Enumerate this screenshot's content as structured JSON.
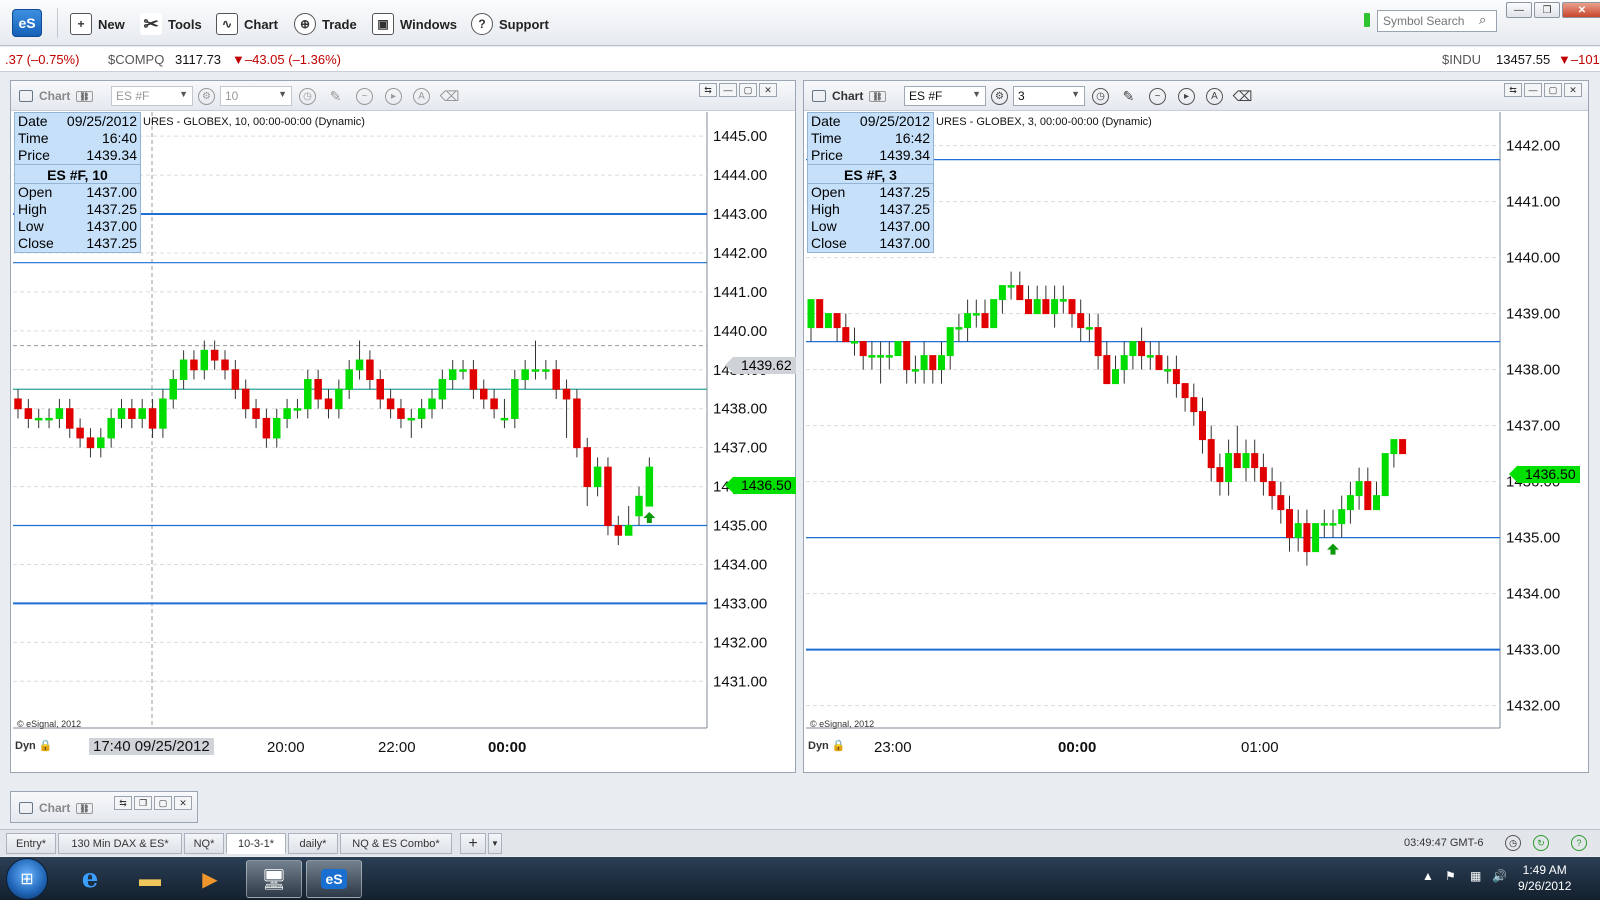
{
  "toolbar": {
    "logo": "eS",
    "new": "New",
    "tools": "Tools",
    "chart": "Chart",
    "trade": "Trade",
    "windows": "Windows",
    "support": "Support",
    "search_placeholder": "Symbol Search"
  },
  "ticker": {
    "left_change": ".37 (–0.75%)",
    "compq_symbol": "$COMPQ",
    "compq_last": "3117.73",
    "compq_change": "▼–43.05 (–1.36%)",
    "indu_symbol": "$INDU",
    "indu_last": "13457.55",
    "indu_change": "▼–101"
  },
  "charts": [
    {
      "title": "Chart",
      "symbol": "ES #F",
      "interval": "10",
      "caption": "URES - GLOBEX, 10, 00:00-00:00 (Dynamic)",
      "info": {
        "date_label": "Date",
        "date": "09/25/2012",
        "time_label": "Time",
        "time": "16:40",
        "price_label": "Price",
        "price": "1439.34",
        "head": "ES #F, 10",
        "open_label": "Open",
        "open": "1437.00",
        "high_label": "High",
        "high": "1437.25",
        "low_label": "Low",
        "low": "1437.00",
        "close_label": "Close",
        "close": "1437.25"
      },
      "last_price": "1436.50",
      "cursor_price": "1439.62",
      "copyright": "© eSignal, 2012",
      "dyn": "Dyn",
      "cursor_time": "17:40 09/25/2012",
      "time_labels": [
        "20:00",
        "22:00",
        "00:00"
      ]
    },
    {
      "title": "Chart",
      "symbol": "ES #F",
      "interval": "3",
      "caption": "URES - GLOBEX, 3, 00:00-00:00 (Dynamic)",
      "info": {
        "date_label": "Date",
        "date": "09/25/2012",
        "time_label": "Time",
        "time": "16:42",
        "price_label": "Price",
        "price": "1439.34",
        "head": "ES #F, 3",
        "open_label": "Open",
        "open": "1437.25",
        "high_label": "High",
        "high": "1437.25",
        "low_label": "Low",
        "low": "1437.00",
        "close_label": "Close",
        "close": "1437.00"
      },
      "last_price": "1436.50",
      "copyright": "© eSignal, 2012",
      "dyn": "Dyn",
      "time_labels": [
        "23:00",
        "00:00",
        "01:00"
      ]
    }
  ],
  "chart_data": [
    {
      "type": "candlestick",
      "title": "",
      "ylim": [
        1430,
        1446
      ],
      "y_ticks": [
        "1431.00",
        "1432.00",
        "1433.00",
        "1434.00",
        "1435.00",
        "1436.00",
        "1437.00",
        "1438.00",
        "1439.00",
        "1440.00",
        "1441.00",
        "1442.00",
        "1443.00",
        "1444.00",
        "1445.00"
      ],
      "x_ticks": [
        "20:00",
        "22:00",
        "00:00"
      ],
      "horizontal_lines": [
        1443.0,
        1441.75,
        1438.5,
        1435.0,
        1433.0
      ],
      "last_price": 1436.5,
      "candles": [
        [
          1438.25,
          1438.5,
          1437.75,
          1438.0
        ],
        [
          1438.0,
          1438.25,
          1437.5,
          1437.75
        ],
        [
          1437.75,
          1438.0,
          1437.5,
          1437.75
        ],
        [
          1437.75,
          1438.0,
          1437.5,
          1437.75
        ],
        [
          1437.75,
          1438.25,
          1437.5,
          1438.0
        ],
        [
          1438.0,
          1438.25,
          1437.25,
          1437.5
        ],
        [
          1437.5,
          1437.75,
          1437.0,
          1437.25
        ],
        [
          1437.25,
          1437.5,
          1436.75,
          1437.0
        ],
        [
          1437.0,
          1437.5,
          1436.75,
          1437.25
        ],
        [
          1437.25,
          1438.0,
          1437.0,
          1437.75
        ],
        [
          1437.75,
          1438.25,
          1437.5,
          1438.0
        ],
        [
          1438.0,
          1438.25,
          1437.5,
          1437.75
        ],
        [
          1437.75,
          1438.25,
          1437.5,
          1438.0
        ],
        [
          1438.0,
          1438.25,
          1437.25,
          1437.5
        ],
        [
          1437.5,
          1438.5,
          1437.25,
          1438.25
        ],
        [
          1438.25,
          1439.0,
          1438.0,
          1438.75
        ],
        [
          1438.75,
          1439.5,
          1438.5,
          1439.25
        ],
        [
          1439.25,
          1439.5,
          1438.75,
          1439.0
        ],
        [
          1439.0,
          1439.75,
          1438.75,
          1439.5
        ],
        [
          1439.5,
          1439.75,
          1439.0,
          1439.25
        ],
        [
          1439.25,
          1439.5,
          1438.75,
          1439.0
        ],
        [
          1439.0,
          1439.25,
          1438.25,
          1438.5
        ],
        [
          1438.5,
          1438.75,
          1437.75,
          1438.0
        ],
        [
          1438.0,
          1438.25,
          1437.5,
          1437.75
        ],
        [
          1437.75,
          1438.0,
          1437.0,
          1437.25
        ],
        [
          1437.25,
          1438.0,
          1437.0,
          1437.75
        ],
        [
          1437.75,
          1438.25,
          1437.5,
          1438.0
        ],
        [
          1438.0,
          1438.25,
          1437.75,
          1438.0
        ],
        [
          1438.0,
          1439.0,
          1437.75,
          1438.75
        ],
        [
          1438.75,
          1439.0,
          1438.0,
          1438.25
        ],
        [
          1438.25,
          1438.5,
          1437.75,
          1438.0
        ],
        [
          1438.0,
          1438.75,
          1437.75,
          1438.5
        ],
        [
          1438.5,
          1439.25,
          1438.25,
          1439.0
        ],
        [
          1439.0,
          1439.75,
          1438.75,
          1439.25
        ],
        [
          1439.25,
          1439.5,
          1438.5,
          1438.75
        ],
        [
          1438.75,
          1439.0,
          1438.0,
          1438.25
        ],
        [
          1438.25,
          1438.5,
          1437.75,
          1438.0
        ],
        [
          1438.0,
          1438.25,
          1437.5,
          1437.75
        ],
        [
          1437.75,
          1438.0,
          1437.25,
          1437.75
        ],
        [
          1437.75,
          1438.25,
          1437.5,
          1438.0
        ],
        [
          1438.0,
          1438.5,
          1437.75,
          1438.25
        ],
        [
          1438.25,
          1439.0,
          1438.0,
          1438.75
        ],
        [
          1438.75,
          1439.25,
          1438.5,
          1439.0
        ],
        [
          1439.0,
          1439.25,
          1438.75,
          1439.0
        ],
        [
          1439.0,
          1439.25,
          1438.25,
          1438.5
        ],
        [
          1438.5,
          1438.75,
          1438.0,
          1438.25
        ],
        [
          1438.25,
          1438.5,
          1437.75,
          1438.0
        ],
        [
          1437.75,
          1438.25,
          1437.5,
          1437.75
        ],
        [
          1437.75,
          1439.0,
          1437.5,
          1438.75
        ],
        [
          1438.75,
          1439.25,
          1438.5,
          1439.0
        ],
        [
          1439.0,
          1439.75,
          1438.75,
          1439.0
        ],
        [
          1439.0,
          1439.25,
          1438.75,
          1439.0
        ],
        [
          1439.0,
          1439.25,
          1438.25,
          1438.5
        ],
        [
          1438.5,
          1438.75,
          1437.25,
          1438.25
        ],
        [
          1438.25,
          1438.5,
          1436.75,
          1437.0
        ],
        [
          1437.0,
          1437.25,
          1435.5,
          1436.0
        ],
        [
          1436.0,
          1436.75,
          1435.75,
          1436.5
        ],
        [
          1436.5,
          1436.75,
          1434.75,
          1435.0
        ],
        [
          1435.0,
          1435.25,
          1434.5,
          1434.75
        ],
        [
          1434.75,
          1435.5,
          1434.75,
          1435.0
        ],
        [
          1435.25,
          1436.0,
          1435.0,
          1435.75
        ],
        [
          1435.5,
          1436.75,
          1435.5,
          1436.5
        ]
      ]
    },
    {
      "type": "candlestick",
      "title": "",
      "ylim": [
        1432,
        1443
      ],
      "y_ticks": [
        "1432.00",
        "1433.00",
        "1434.00",
        "1435.00",
        "1436.00",
        "1437.00",
        "1438.00",
        "1439.00",
        "1440.00",
        "1441.00",
        "1442.00"
      ],
      "x_ticks": [
        "23:00",
        "00:00",
        "01:00"
      ],
      "horizontal_lines": [
        1441.75,
        1438.5,
        1435.0,
        1433.0
      ],
      "last_price": 1436.5,
      "candles": [
        [
          1438.75,
          1439.25,
          1438.5,
          1439.25
        ],
        [
          1439.25,
          1439.25,
          1438.75,
          1438.75
        ],
        [
          1438.75,
          1439.0,
          1438.75,
          1439.0
        ],
        [
          1439.0,
          1439.0,
          1438.5,
          1438.75
        ],
        [
          1438.75,
          1439.0,
          1438.5,
          1438.5
        ],
        [
          1438.5,
          1438.75,
          1438.25,
          1438.5
        ],
        [
          1438.5,
          1438.5,
          1438.0,
          1438.25
        ],
        [
          1438.25,
          1438.5,
          1438.0,
          1438.25
        ],
        [
          1438.25,
          1438.5,
          1437.75,
          1438.25
        ],
        [
          1438.25,
          1438.5,
          1438.0,
          1438.25
        ],
        [
          1438.25,
          1438.5,
          1438.25,
          1438.5
        ],
        [
          1438.5,
          1438.5,
          1437.75,
          1438.0
        ],
        [
          1438.0,
          1438.25,
          1437.75,
          1438.0
        ],
        [
          1438.0,
          1438.5,
          1437.75,
          1438.25
        ],
        [
          1438.25,
          1438.25,
          1437.75,
          1438.0
        ],
        [
          1438.0,
          1438.5,
          1437.75,
          1438.25
        ],
        [
          1438.25,
          1438.75,
          1438.0,
          1438.75
        ],
        [
          1438.75,
          1439.0,
          1438.5,
          1438.75
        ],
        [
          1438.75,
          1439.25,
          1438.5,
          1439.0
        ],
        [
          1439.0,
          1439.25,
          1438.75,
          1439.0
        ],
        [
          1439.0,
          1439.25,
          1438.75,
          1438.75
        ],
        [
          1438.75,
          1439.25,
          1438.75,
          1439.25
        ],
        [
          1439.25,
          1439.5,
          1439.0,
          1439.5
        ],
        [
          1439.5,
          1439.75,
          1439.25,
          1439.5
        ],
        [
          1439.5,
          1439.75,
          1439.25,
          1439.25
        ],
        [
          1439.25,
          1439.5,
          1439.0,
          1439.0
        ],
        [
          1439.0,
          1439.5,
          1439.0,
          1439.25
        ],
        [
          1439.25,
          1439.5,
          1439.0,
          1439.0
        ],
        [
          1439.0,
          1439.5,
          1438.75,
          1439.25
        ],
        [
          1439.25,
          1439.5,
          1439.0,
          1439.25
        ],
        [
          1439.25,
          1439.25,
          1438.75,
          1439.0
        ],
        [
          1439.0,
          1439.25,
          1438.5,
          1438.75
        ],
        [
          1438.75,
          1439.0,
          1438.5,
          1438.75
        ],
        [
          1438.75,
          1439.0,
          1438.0,
          1438.25
        ],
        [
          1438.25,
          1438.5,
          1437.75,
          1437.75
        ],
        [
          1437.75,
          1438.25,
          1437.75,
          1438.0
        ],
        [
          1438.0,
          1438.5,
          1437.75,
          1438.25
        ],
        [
          1438.25,
          1438.5,
          1438.0,
          1438.5
        ],
        [
          1438.5,
          1438.75,
          1438.0,
          1438.25
        ],
        [
          1438.25,
          1438.5,
          1438.0,
          1438.25
        ],
        [
          1438.25,
          1438.5,
          1438.0,
          1438.0
        ],
        [
          1438.0,
          1438.25,
          1437.75,
          1438.0
        ],
        [
          1438.0,
          1438.25,
          1437.5,
          1437.75
        ],
        [
          1437.75,
          1437.75,
          1437.25,
          1437.5
        ],
        [
          1437.5,
          1437.75,
          1437.0,
          1437.25
        ],
        [
          1437.25,
          1437.5,
          1436.5,
          1436.75
        ],
        [
          1436.75,
          1437.0,
          1436.0,
          1436.25
        ],
        [
          1436.25,
          1436.5,
          1435.75,
          1436.0
        ],
        [
          1436.0,
          1436.75,
          1435.75,
          1436.5
        ],
        [
          1436.5,
          1437.0,
          1436.25,
          1436.25
        ],
        [
          1436.25,
          1436.75,
          1436.0,
          1436.5
        ],
        [
          1436.5,
          1436.75,
          1436.0,
          1436.25
        ],
        [
          1436.25,
          1436.5,
          1435.75,
          1436.0
        ],
        [
          1436.0,
          1436.25,
          1435.5,
          1435.75
        ],
        [
          1435.75,
          1436.0,
          1435.25,
          1435.5
        ],
        [
          1435.5,
          1435.75,
          1434.75,
          1435.0
        ],
        [
          1435.0,
          1435.5,
          1434.75,
          1435.25
        ],
        [
          1435.25,
          1435.5,
          1434.5,
          1434.75
        ],
        [
          1434.75,
          1435.25,
          1434.75,
          1435.25
        ],
        [
          1435.25,
          1435.5,
          1435.0,
          1435.25
        ],
        [
          1435.25,
          1435.5,
          1435.0,
          1435.25
        ],
        [
          1435.25,
          1435.75,
          1435.0,
          1435.5
        ],
        [
          1435.5,
          1436.0,
          1435.25,
          1435.75
        ],
        [
          1435.75,
          1436.25,
          1435.5,
          1436.0
        ],
        [
          1436.0,
          1436.25,
          1435.5,
          1435.5
        ],
        [
          1435.5,
          1436.0,
          1435.5,
          1435.75
        ],
        [
          1435.75,
          1436.5,
          1435.75,
          1436.5
        ],
        [
          1436.5,
          1436.75,
          1436.25,
          1436.75
        ],
        [
          1436.75,
          1436.75,
          1436.5,
          1436.5
        ]
      ]
    }
  ],
  "bottom_chart": {
    "title": "Chart"
  },
  "page_tabs": [
    "Entry*",
    "130 Min DAX & ES*",
    "NQ*",
    "10-3-1*",
    "daily*",
    "NQ & ES Combo*"
  ],
  "active_tab": "10-3-1*",
  "status": {
    "clock": "03:49:47 GMT-6"
  },
  "taskbar": {
    "time": "1:49 AM",
    "date": "9/26/2012",
    "es_label": "eS"
  },
  "colors": {
    "up": "#00dd00",
    "down": "#e00000",
    "level_line": "#1f6fd6",
    "last_tag": "#00e000"
  }
}
